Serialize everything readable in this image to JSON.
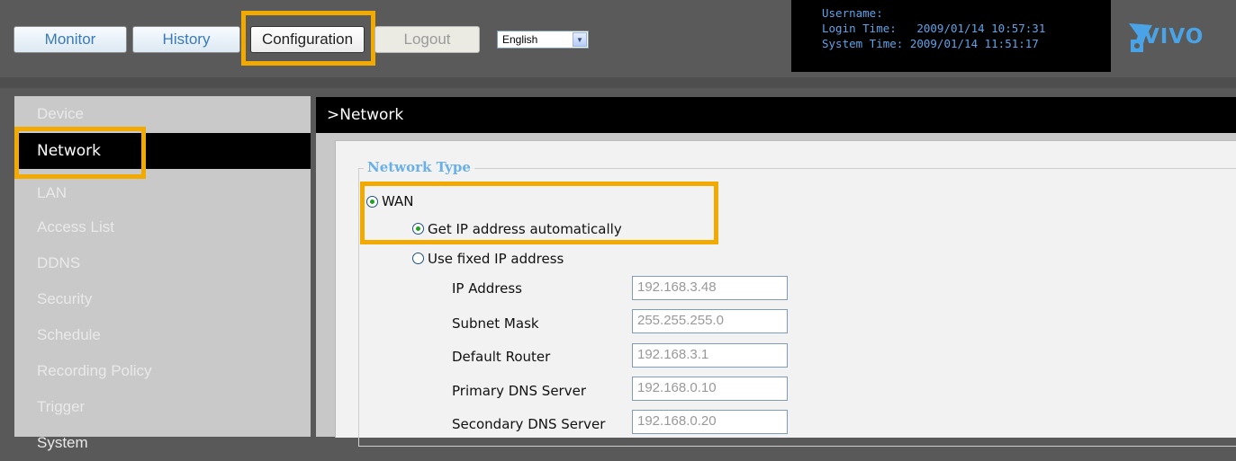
{
  "header": {
    "buttons": {
      "monitor": "Monitor",
      "history": "History",
      "configuration": "Configuration",
      "logout": "Logout"
    },
    "language": {
      "selected": "English"
    },
    "info": {
      "username_label": "Username:",
      "login_time": "Login Time:   2009/01/14 10:57:31",
      "system_time": "System Time: 2009/01/14 11:51:17"
    },
    "logo_text": "VIVO"
  },
  "sidebar": {
    "items": [
      {
        "label": "Device"
      },
      {
        "label": "Network"
      },
      {
        "label": "LAN"
      },
      {
        "label": "Access List"
      },
      {
        "label": "DDNS"
      },
      {
        "label": "Security"
      },
      {
        "label": "Schedule"
      },
      {
        "label": "Recording Policy"
      },
      {
        "label": "Trigger"
      },
      {
        "label": "System"
      }
    ]
  },
  "main": {
    "title": ">Network",
    "legend": "Network Type",
    "wan_label": "WAN",
    "auto_label": "Get IP address automatically",
    "fixed_label": "Use fixed IP address",
    "fields": [
      {
        "label": "IP Address",
        "value": "192.168.3.48"
      },
      {
        "label": "Subnet Mask",
        "value": "255.255.255.0"
      },
      {
        "label": "Default Router",
        "value": "192.168.3.1"
      },
      {
        "label": "Primary DNS Server",
        "value": "192.168.0.10"
      },
      {
        "label": "Secondary DNS Server",
        "value": "192.168.0.20"
      }
    ]
  },
  "colors": {
    "highlight": "#f2a900",
    "info_text": "#5ca4e8",
    "legend_text": "#6ab0e8"
  }
}
